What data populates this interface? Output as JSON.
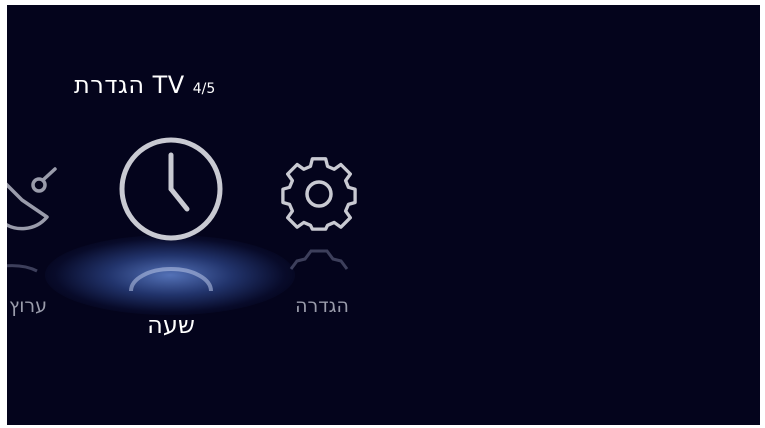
{
  "header": {
    "title": "הגדרת TV",
    "step": "4/5"
  },
  "menu": {
    "items": [
      {
        "label": "ערוץ",
        "icon": "satellite-dish-icon",
        "state": "partial"
      },
      {
        "label": "שעה",
        "icon": "clock-icon",
        "state": "selected"
      },
      {
        "label": "הגדרה",
        "icon": "gear-icon",
        "state": "normal"
      }
    ]
  },
  "colors": {
    "background": "#04041c",
    "highlight": "#6e96eb",
    "text": "#ffffff",
    "text_dim": "#9a9cab"
  }
}
